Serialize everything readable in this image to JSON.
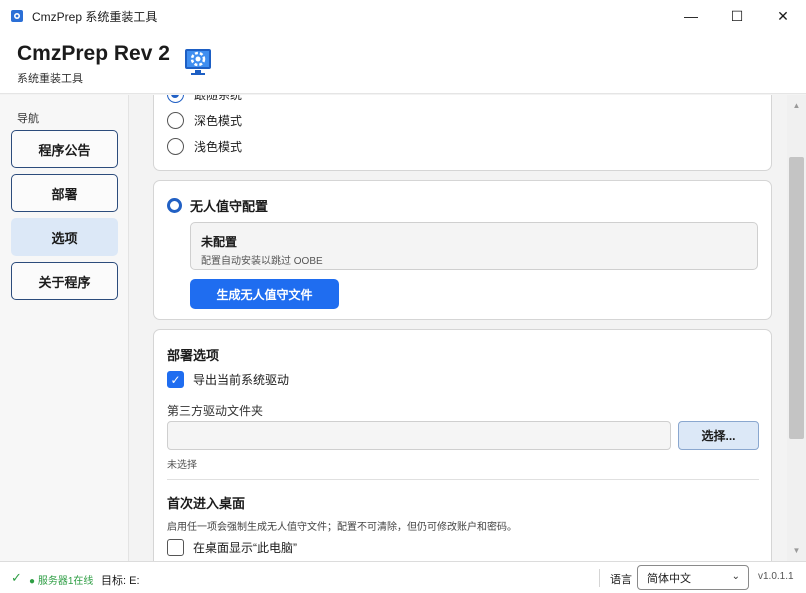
{
  "window": {
    "title": "CmzPrep 系统重装工具",
    "minimize_glyph": "—",
    "maximize_glyph": "☐",
    "close_glyph": "✕"
  },
  "header": {
    "title": "CmzPrep Rev 2",
    "subtitle": "系统重装工具",
    "logo_icon": "gear-monitor-icon"
  },
  "nav": {
    "label": "导航",
    "items": [
      {
        "label": "程序公告",
        "active": false
      },
      {
        "label": "部署",
        "active": false
      },
      {
        "label": "选项",
        "active": true
      },
      {
        "label": "关于程序",
        "active": false
      }
    ]
  },
  "theme": {
    "options": [
      {
        "label": "跟随系统",
        "selected": true
      },
      {
        "label": "深色模式",
        "selected": false
      },
      {
        "label": "浅色模式",
        "selected": false
      }
    ]
  },
  "unattend": {
    "title": "无人值守配置",
    "status_title": "未配置",
    "status_desc": "配置自动安装以跳过 OOBE",
    "generate_button": "生成无人值守文件"
  },
  "deploy_options": {
    "title": "部署选项",
    "export_drivers_label": "导出当前系统驱动",
    "export_drivers_checked": true,
    "third_party_label": "第三方驱动文件夹",
    "folder_value": "",
    "browse_button": "选择...",
    "folder_hint": "未选择",
    "first_desktop_title": "首次进入桌面",
    "first_desktop_desc": "启用任一项会强制生成无人值守文件；配置不可清除，但仍可修改账户和密码。",
    "show_this_pc_label": "在桌面显示“此电脑”",
    "show_this_pc_checked": false
  },
  "status": {
    "check_glyph": "✓",
    "server": "● 服务器1在线",
    "target": "目标: E:",
    "language_label": "语言",
    "language_value": "简体中文",
    "version": "v1.0.1.1"
  },
  "colors": {
    "accent": "#1f6df0",
    "nav_active": "#dce8f7",
    "online_green": "#2e9e44"
  }
}
